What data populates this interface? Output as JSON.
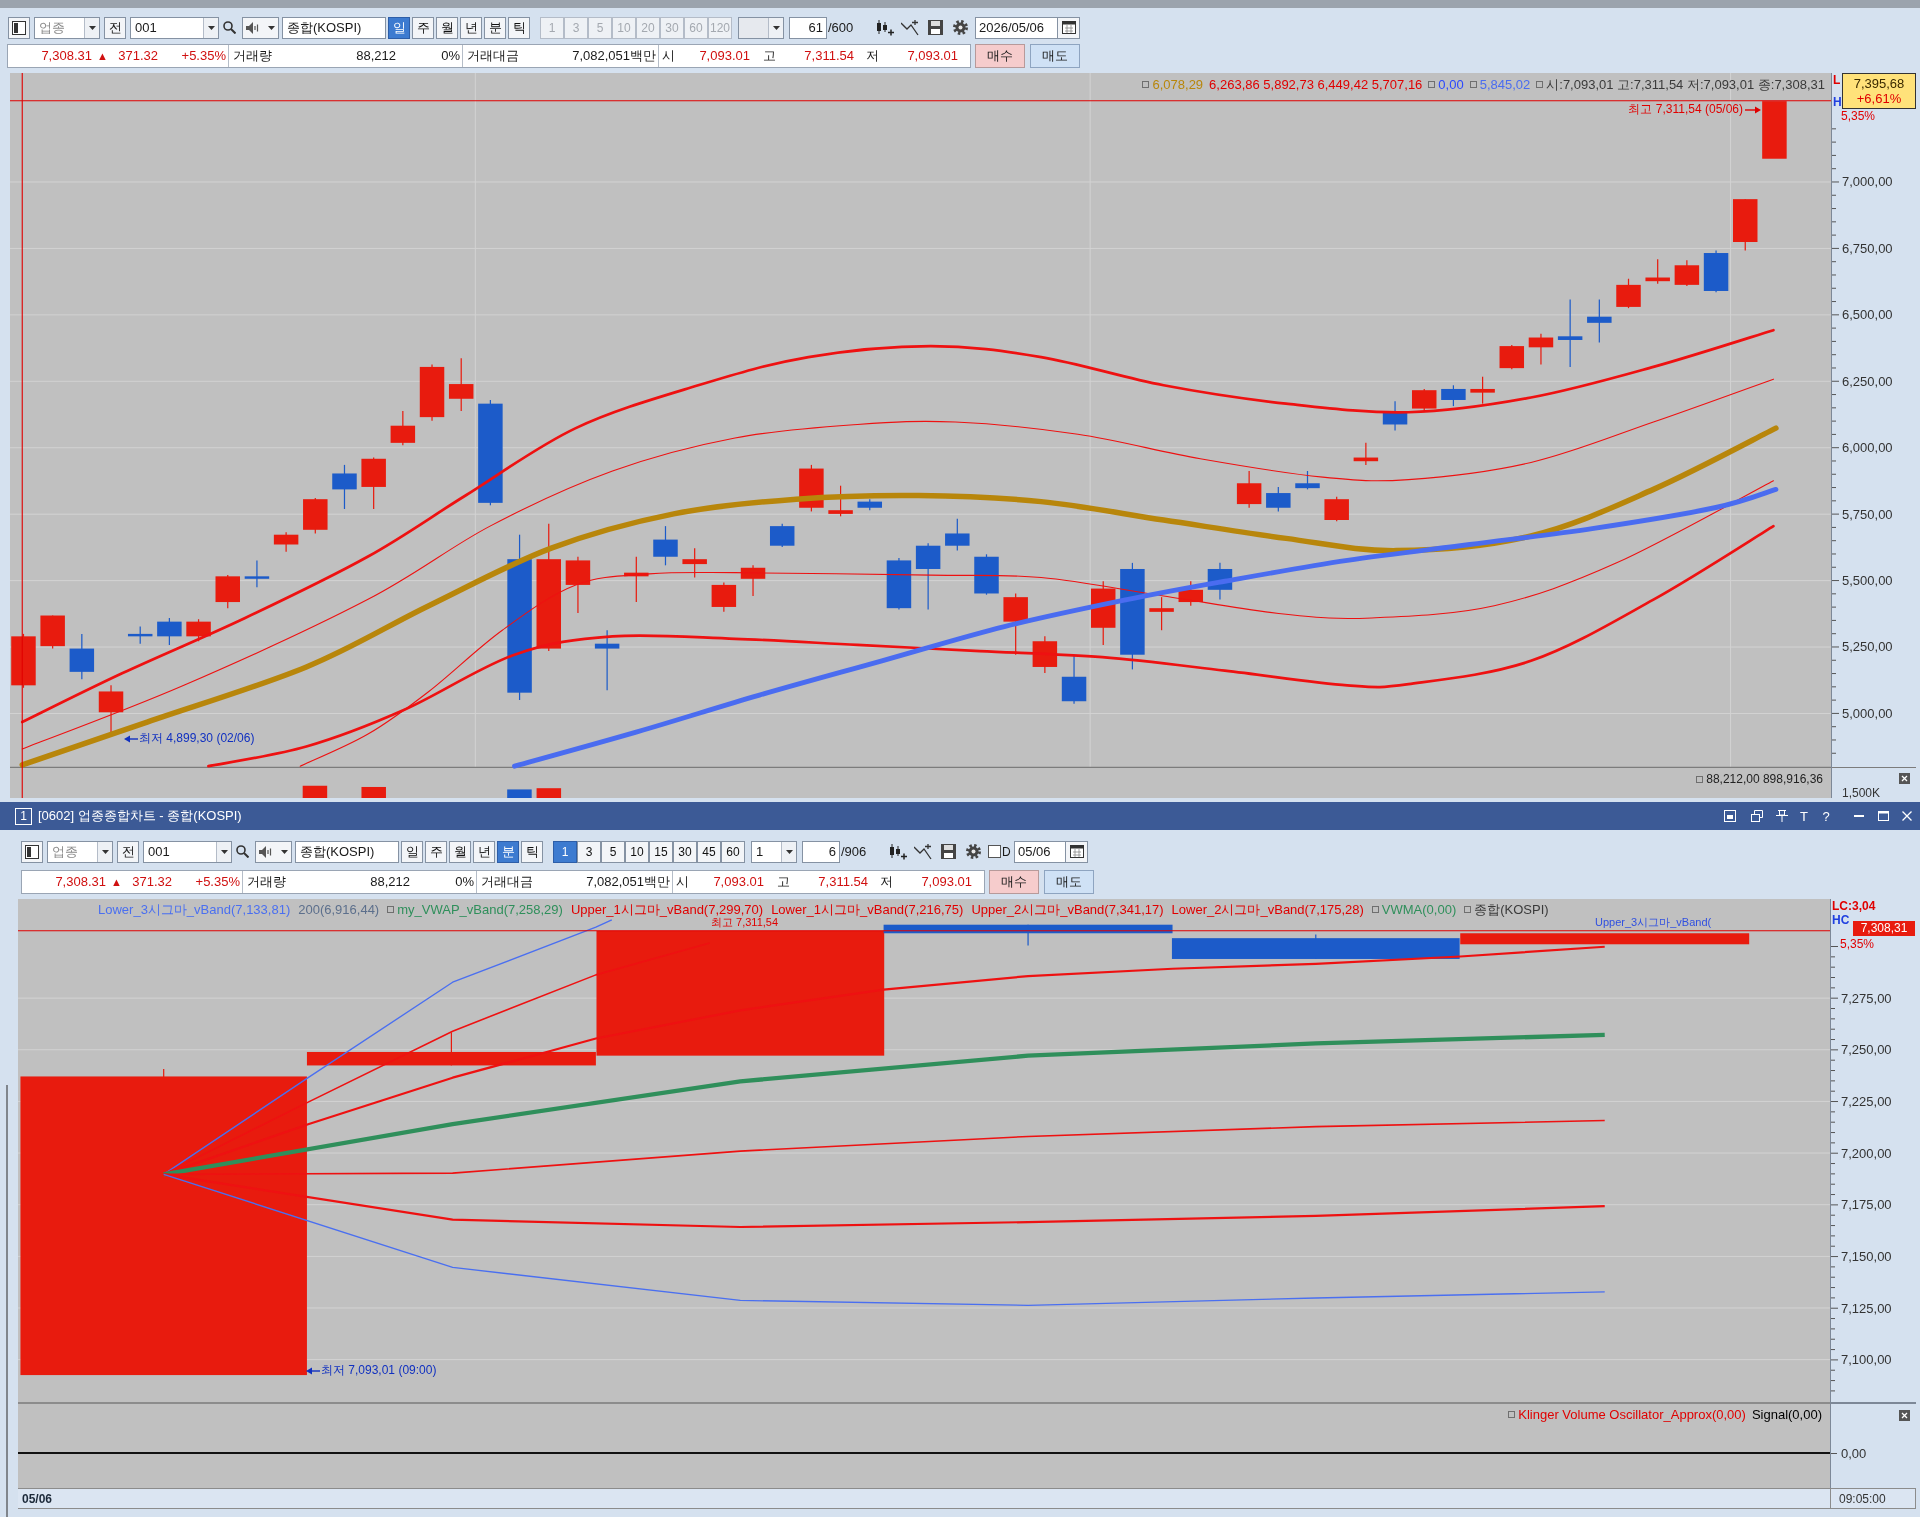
{
  "top_window": {
    "toolbar": {
      "market": "업종",
      "prev": "전",
      "code": "001",
      "name": "종합(KOSPI)",
      "periods": [
        {
          "label": "일",
          "selected": true
        },
        {
          "label": "주",
          "selected": false
        },
        {
          "label": "월",
          "selected": false
        },
        {
          "label": "년",
          "selected": false
        },
        {
          "label": "분",
          "selected": false
        },
        {
          "label": "틱",
          "selected": false
        }
      ],
      "intervals": [
        {
          "label": "1",
          "selected": false,
          "disabled": true
        },
        {
          "label": "3",
          "selected": false,
          "disabled": true
        },
        {
          "label": "5",
          "selected": false,
          "disabled": true
        },
        {
          "label": "10",
          "selected": false,
          "disabled": true
        },
        {
          "label": "20",
          "selected": false,
          "disabled": true
        },
        {
          "label": "30",
          "selected": false,
          "disabled": true
        },
        {
          "label": "60",
          "selected": false,
          "disabled": true
        },
        {
          "label": "120",
          "selected": false,
          "disabled": true
        }
      ],
      "interval_combo": {
        "disabled": true
      },
      "count": "61",
      "count_total": "/600",
      "date": "2026/05/06"
    },
    "quote": {
      "price": "7,308.31",
      "arrow": "▲",
      "change": "371.32",
      "change_rate": "+5.35%",
      "volume_label": "거래량",
      "volume": "88,212",
      "volume_ratio": "0%",
      "amount_label": "거래대금",
      "amount": "7,082,051백만",
      "open_label": "시",
      "open": "7,093.01",
      "high_label": "고",
      "high": "7,311.54",
      "low_label": "저",
      "low": "7,093.01",
      "buy": "매수",
      "sell": "매도"
    },
    "chart": {
      "legend": [
        {
          "text": "6,078,29",
          "color": "#b8860b",
          "marker": true
        },
        {
          "text": "6,263,86 5,892,73 6,449,42 5,707,16",
          "color": "#e00000",
          "marker": false
        },
        {
          "text": "0,00",
          "color": "#2a48ff",
          "marker": true
        },
        {
          "text": "5,845,02",
          "color": "#4a6cf0",
          "marker": true
        },
        {
          "text": "시:7,093,01 고:7,311,54 저:7,093,01 종:7,308,31",
          "color": "#3a3a3a",
          "marker": true
        }
      ],
      "high_label": "최고 7,311,54 (05/06)",
      "low_label": "최저 4,899,30 (02/06)",
      "price_box": {
        "price": "7,395,68",
        "change": "+6,61%"
      },
      "axis_flags": [
        {
          "text": "L",
          "color": "#e00000"
        },
        {
          "text": "H",
          "color": "#2040e0"
        }
      ],
      "axis_rate": "5,35%",
      "y_ticks": [
        "7,000,00",
        "6,750,00",
        "6,500,00",
        "6,250,00",
        "6,000,00",
        "5,750,00",
        "5,500,00",
        "5,250,00",
        "5,000,00"
      ],
      "volume_legend": "88,212,00 898,916,36",
      "volume_axis": "1,500K"
    }
  },
  "title_bar": {
    "number": "1",
    "title": "[0602] 업종종합차트 - 종합(KOSPI)",
    "tool_buttons": [
      "T",
      "?"
    ]
  },
  "bottom_window": {
    "toolbar": {
      "market": "업종",
      "prev": "전",
      "code": "001",
      "name": "종합(KOSPI)",
      "periods": [
        {
          "label": "일",
          "selected": false
        },
        {
          "label": "주",
          "selected": false
        },
        {
          "label": "월",
          "selected": false
        },
        {
          "label": "년",
          "selected": false
        },
        {
          "label": "분",
          "selected": true
        },
        {
          "label": "틱",
          "selected": false
        }
      ],
      "intervals": [
        {
          "label": "1",
          "selected": true,
          "disabled": false
        },
        {
          "label": "3",
          "selected": false,
          "disabled": false
        },
        {
          "label": "5",
          "selected": false,
          "disabled": false
        },
        {
          "label": "10",
          "selected": false,
          "disabled": false
        },
        {
          "label": "15",
          "selected": false,
          "disabled": false
        },
        {
          "label": "30",
          "selected": false,
          "disabled": false
        },
        {
          "label": "45",
          "selected": false,
          "disabled": false
        },
        {
          "label": "60",
          "selected": false,
          "disabled": false
        }
      ],
      "interval_combo": {
        "value": "1",
        "disabled": false
      },
      "count": "6",
      "count_total": "/906",
      "checkbox": {
        "label": "D",
        "checked": false
      },
      "date": "05/06"
    },
    "quote": {
      "price": "7,308.31",
      "arrow": "▲",
      "change": "371.32",
      "change_rate": "+5.35%",
      "volume_label": "거래량",
      "volume": "88,212",
      "volume_ratio": "0%",
      "amount_label": "거래대금",
      "amount": "7,082,051백만",
      "open_label": "시",
      "open": "7,093.01",
      "high_label": "고",
      "high": "7,311.54",
      "low_label": "저",
      "low": "7,093.01",
      "buy": "매수",
      "sell": "매도"
    },
    "chart": {
      "legend": [
        {
          "text": "Lower_3시그마_vBand(7,133,81)",
          "color": "#4a6ff0",
          "marker": false
        },
        {
          "text": "200(6,916,44)",
          "color": "#5c6f8c",
          "marker": false
        },
        {
          "text": "my_VWAP_vBand(7,258,29)",
          "color": "#2f8f5b",
          "marker": true
        },
        {
          "text": "Upper_1시그마_vBand(7,299,70)",
          "color": "#e00000",
          "marker": false
        },
        {
          "text": "Lower_1시그마_vBand(7,216,75)",
          "color": "#e00000",
          "marker": false
        },
        {
          "text": "Upper_2시그마_vBand(7,341,17)",
          "color": "#e00000",
          "marker": false
        },
        {
          "text": "Lower_2시그마_vBand(7,175,28)",
          "color": "#e00000",
          "marker": false
        },
        {
          "text": "VWMA(0,00)",
          "color": "#2f8f5b",
          "marker": true
        },
        {
          "text": "종합(KOSPI)",
          "color": "#3a3a3a",
          "marker": true
        }
      ],
      "high_label": "최고 7,311,54",
      "overlay_label": "Upper_3시그마_vBand(",
      "low_label": "최저 7,093,01 (09:00)",
      "price_box": {
        "price": "7,308,31"
      },
      "axis_flags": [
        {
          "text": "LC:3,04",
          "color": "#e00000"
        },
        {
          "text": "HC",
          "color": "#2040e0"
        }
      ],
      "axis_rate": "5,35%",
      "y_ticks": [
        "7,275,00",
        "7,250,00",
        "7,225,00",
        "7,200,00",
        "7,175,00",
        "7,150,00",
        "7,125,00",
        "7,100,00"
      ]
    },
    "oscillator": {
      "legend": [
        {
          "text": "Klinger Volume Oscillator_Approx(0,00)",
          "color": "#e00000",
          "marker": true
        },
        {
          "text": "Signal(0,00)",
          "color": "#000000",
          "marker": false
        }
      ],
      "axis_label": "0,00"
    },
    "date_bar": {
      "date": "05/06",
      "time": "09:05:00"
    }
  }
}
